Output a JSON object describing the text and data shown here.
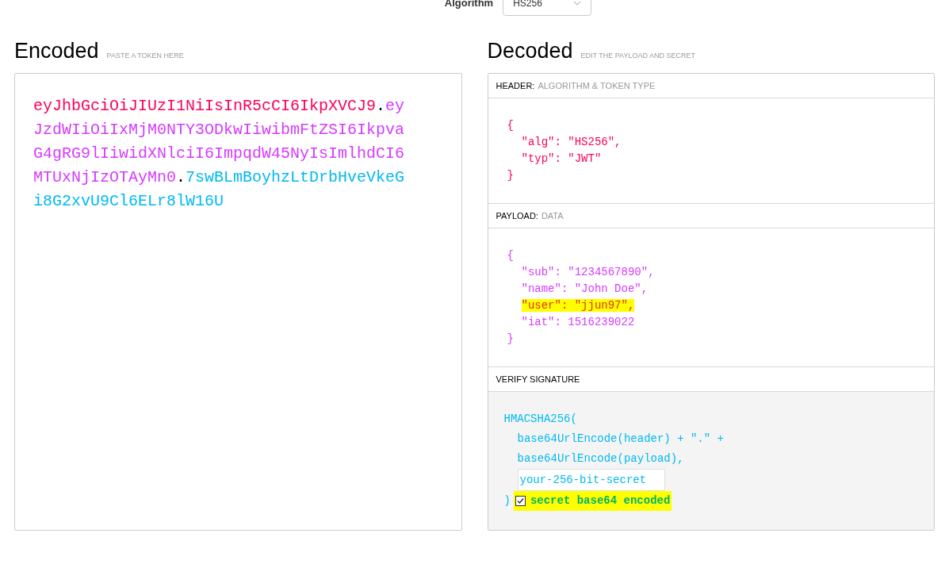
{
  "algorithm": {
    "label": "Algorithm",
    "value": "HS256"
  },
  "encoded": {
    "title": "Encoded",
    "hint": "PASTE A TOKEN HERE",
    "parts": [
      {
        "kind": "header",
        "text": "eyJhbGciOiJIUzI1NiIsInR5cCI6IkpXVCJ9"
      },
      {
        "kind": "dot",
        "text": "."
      },
      {
        "kind": "payload",
        "text": "eyJzdWIiOiIxMjM0NTY3ODkwIiwibmFtZSI6IkpvaG4gRG9lIiwidXNlciI6ImpqdW45NyIsImlhdCI6MTUxNjIzOTAyMn0"
      },
      {
        "kind": "dot",
        "text": "."
      },
      {
        "kind": "signature",
        "text": "7swBLmBoyhzLtDrbHveVkeGi8G2xvU9Cl6ELr8lW16U"
      }
    ]
  },
  "decoded": {
    "title": "Decoded",
    "hint": "EDIT THE PAYLOAD AND SECRET",
    "header": {
      "label": "HEADER:",
      "hint": "ALGORITHM & TOKEN TYPE",
      "open": "{",
      "close": "}",
      "entries": [
        {
          "text": "\"alg\": \"HS256\",",
          "highlighted": false
        },
        {
          "text": "\"typ\": \"JWT\"",
          "highlighted": false
        }
      ]
    },
    "payload": {
      "label": "PAYLOAD:",
      "hint": "DATA",
      "open": "{",
      "close": "}",
      "entries": [
        {
          "text": "\"sub\": \"1234567890\",",
          "highlighted": false
        },
        {
          "text": "\"name\": \"John Doe\",",
          "highlighted": false
        },
        {
          "text": "\"user\": \"jjun97\",",
          "highlighted": true
        },
        {
          "text": "\"iat\": 1516239022",
          "highlighted": false
        }
      ]
    },
    "verify": {
      "label": "VERIFY SIGNATURE",
      "function": "HMACSHA256(",
      "args": [
        "base64UrlEncode(header) + \".\" +",
        "base64UrlEncode(payload),"
      ],
      "secret": "your-256-bit-secret",
      "close": ")",
      "base64": {
        "label": "secret base64 encoded",
        "checked": true,
        "highlighted": true
      }
    }
  }
}
